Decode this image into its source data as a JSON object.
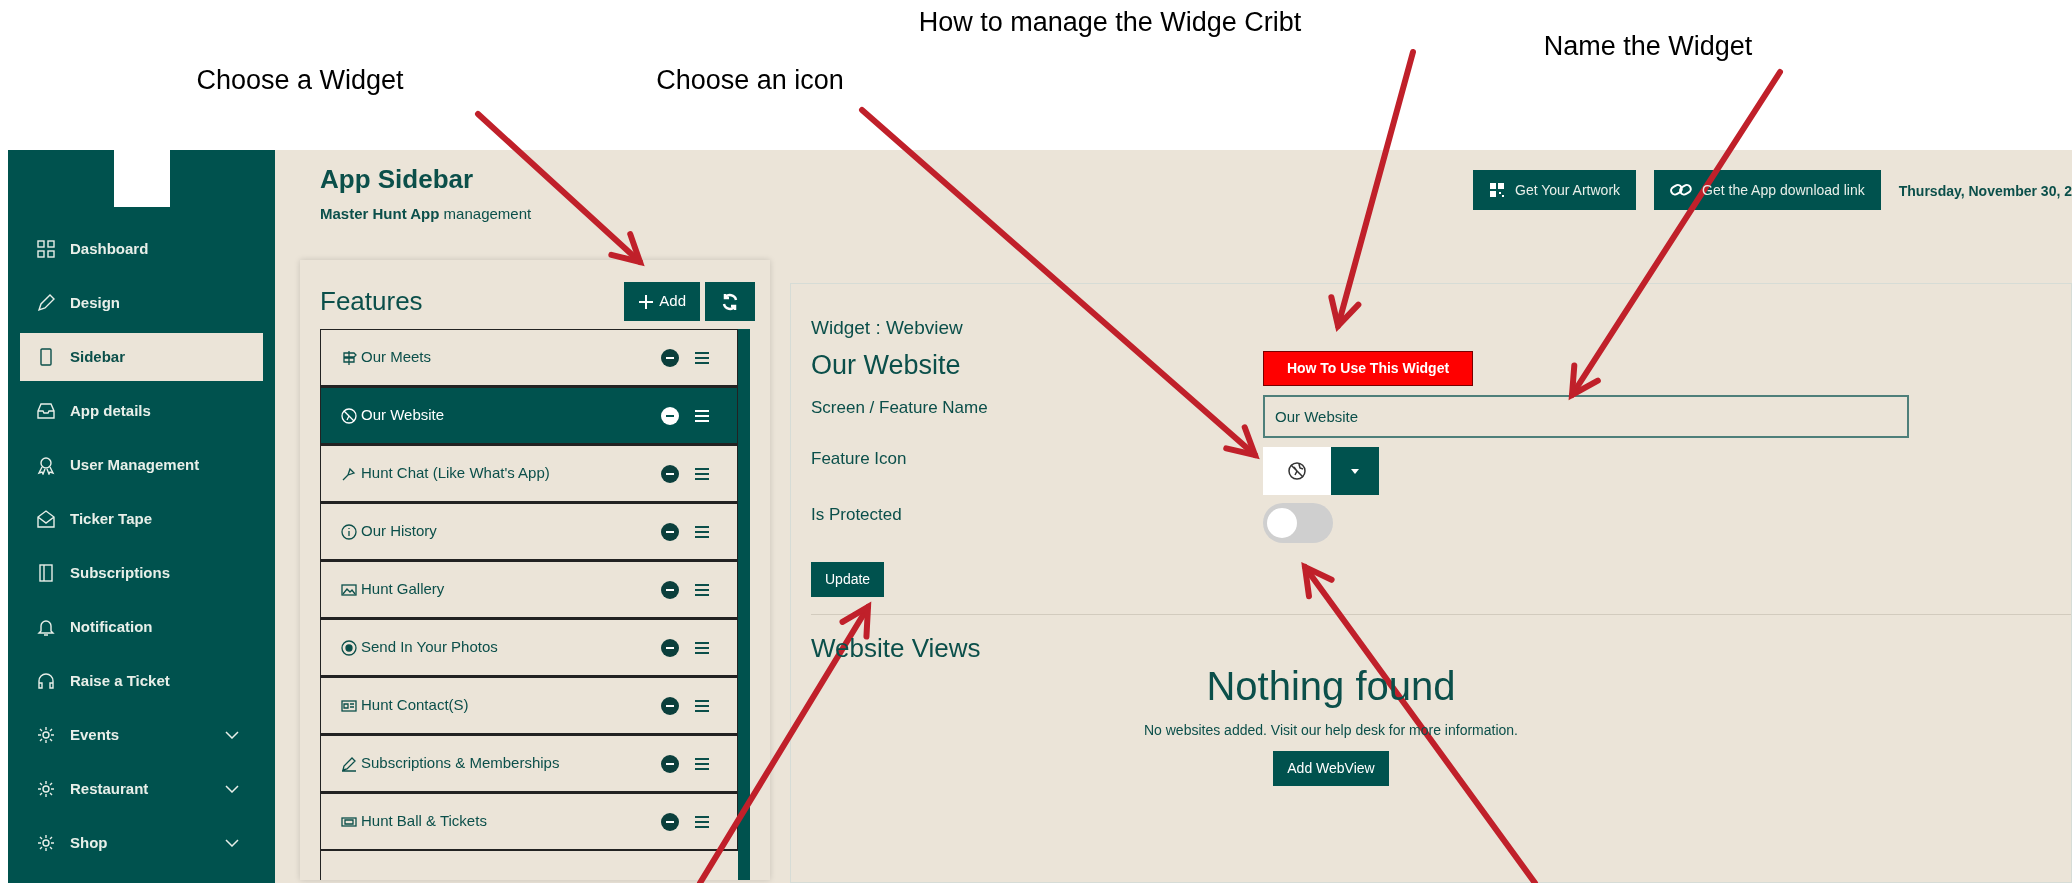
{
  "annotations": [
    {
      "label": "Choose a Widget"
    },
    {
      "label": "Choose an icon"
    },
    {
      "label": "How to manage the Widge Cribt"
    },
    {
      "label": "Name the Widget"
    }
  ],
  "sidebar": {
    "items": [
      {
        "label": "Dashboard",
        "kind": "link",
        "selected": false
      },
      {
        "label": "Design",
        "kind": "link",
        "selected": false
      },
      {
        "label": "Sidebar",
        "kind": "link",
        "selected": true
      },
      {
        "label": "App details",
        "kind": "link",
        "selected": false
      },
      {
        "label": "User Management",
        "kind": "link",
        "selected": false
      },
      {
        "label": "Ticker Tape",
        "kind": "link",
        "selected": false
      },
      {
        "label": "Subscriptions",
        "kind": "link",
        "selected": false
      },
      {
        "label": "Notification",
        "kind": "link",
        "selected": false
      },
      {
        "label": "Raise a Ticket",
        "kind": "link",
        "selected": false
      },
      {
        "label": "Events",
        "kind": "group",
        "selected": false
      },
      {
        "label": "Restaurant",
        "kind": "group",
        "selected": false
      },
      {
        "label": "Shop",
        "kind": "group",
        "selected": false
      }
    ]
  },
  "header": {
    "title": "App Sidebar",
    "subtitle": "**Master Hunt App** management",
    "buttons": [
      "Get Your Artwork",
      "Get the App download link"
    ],
    "date": "Thursday, November 30, 2"
  },
  "features": {
    "title": "Features",
    "add_button": "Add",
    "items": [
      {
        "label": "Our Meets",
        "selected": false
      },
      {
        "label": "Our Website",
        "selected": true
      },
      {
        "label": "Hunt Chat (Like What's App)",
        "selected": false
      },
      {
        "label": "Our History",
        "selected": false
      },
      {
        "label": "Hunt Gallery",
        "selected": false
      },
      {
        "label": "Send In Your Photos",
        "selected": false
      },
      {
        "label": "Hunt Contact(S)",
        "selected": false
      },
      {
        "label": "Subscriptions & Memberships",
        "selected": false
      },
      {
        "label": "Hunt Ball & Tickets",
        "selected": false
      }
    ]
  },
  "widget": {
    "type_label": "Widget : Webview",
    "name": "Our Website",
    "help_button": "How To Use This Widget",
    "fields": {
      "name_label": "Screen / Feature Name",
      "name_value": "Our Website",
      "icon_label": "Feature Icon",
      "protected_label": "Is Protected",
      "protected": false
    },
    "update_button": "Update",
    "views_title": "Website Views",
    "empty_title": "Nothing found",
    "empty_text": "No websites added. Visit our help desk for more information.",
    "add_button": "Add WebView"
  }
}
